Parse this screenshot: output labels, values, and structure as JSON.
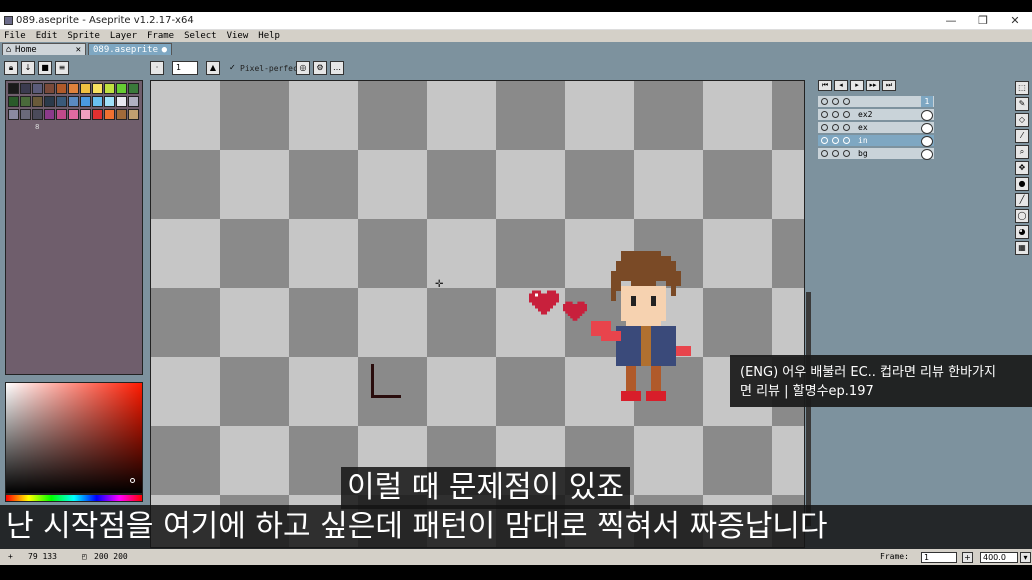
{
  "window": {
    "title": "089.aseprite - Aseprite v1.2.17-x64",
    "minimize": "—",
    "maximize": "❐",
    "close": "✕"
  },
  "menu": [
    "File",
    "Edit",
    "Sprite",
    "Layer",
    "Frame",
    "Select",
    "View",
    "Help"
  ],
  "tabs": {
    "home": {
      "label": "Home",
      "close": "✕"
    },
    "file": {
      "label": "089.aseprite",
      "modified": "●"
    }
  },
  "toolbar": {
    "brush_size": "1",
    "pixel_perfect_check": "✓",
    "pixel_perfect_label": "Pixel-perfect"
  },
  "palette": {
    "colors": [
      "#1a1a1a",
      "#3b3b4f",
      "#5b5b7a",
      "#7a4a3a",
      "#b05a2a",
      "#e0823c",
      "#f0c040",
      "#f8e060",
      "#c0e040",
      "#66cc33",
      "#3a7a3a",
      "#2a5a2a",
      "#4a6a3a",
      "#6a5a3a",
      "#2a3a4a",
      "#3a5a7a",
      "#5a8ac0",
      "#4a9ae0",
      "#6ac0f0",
      "#a0e0f8",
      "#e8e8f0",
      "#b0b0c0",
      "#8a8aa0",
      "#6a6a7a",
      "#4a4a5a",
      "#8a3a8a",
      "#c04a8a",
      "#e06aa0",
      "#f0a0c0",
      "#e03030",
      "#f07030",
      "#a06a3a",
      "#c0a070"
    ],
    "index_label": "8"
  },
  "layers": [
    {
      "name": "",
      "visible": true,
      "active": false
    },
    {
      "name": "ex2",
      "visible": false,
      "active": false
    },
    {
      "name": "ex",
      "visible": false,
      "active": false
    },
    {
      "name": "in",
      "visible": true,
      "active": true
    },
    {
      "name": "bg",
      "visible": false,
      "active": false
    }
  ],
  "timeline": {
    "frame_number": "1"
  },
  "status": {
    "cursor_icon": "+",
    "cursor_pos": "79 133",
    "size_icon": "◰",
    "size": "200 200",
    "frame_label": "Frame:",
    "frame_value": "1",
    "zoom": "400.0"
  },
  "tooltip": {
    "line1": "(ENG) 어우 배불러 EC.. 컵라면 리뷰 한바가지",
    "line2": "면 리뷰 | 할명수ep.197"
  },
  "subtitles": {
    "line1": "이럴 때 문제점이 있죠",
    "line2": "난 시작점을 여기에 하고 싶은데 패턴이 맘대로 찍혀서 짜증납니다"
  },
  "colors": {
    "accent_tab": "#7ea7c2",
    "workspace_bg": "#7d929e",
    "palette_bg": "#6f5e6c"
  }
}
